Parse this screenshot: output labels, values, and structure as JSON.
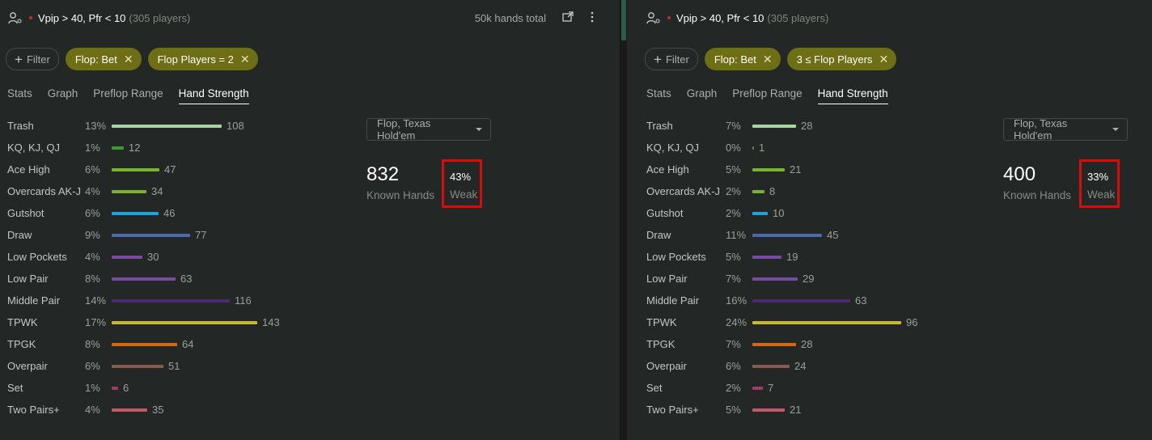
{
  "colors": {
    "chip": "#6e6e14",
    "highlight_box": "#d90b0b",
    "bars": {
      "trash": "#a8d5a2",
      "kq": "#3a9a2a",
      "ace_high": "#7ab32e",
      "overcards": "#7ab32e",
      "gutshot": "#1aa6d9",
      "draw": "#4a6aad",
      "low_pockets": "#7a4aa0",
      "low_pair": "#7a4aa0",
      "middle_pair": "#4a2a70",
      "tpwk": "#c9b82a",
      "tpgk": "#d06a18",
      "overpair": "#8a5a50",
      "set": "#a03a6a",
      "two_pairs": "#c05a6a"
    }
  },
  "left": {
    "segment": "Vpip > 40, Pfr < 10",
    "player_count": "(305 players)",
    "hands_total": "50k hands total",
    "filter_label": "Filter",
    "chips": [
      "Flop: Bet",
      "Flop Players = 2"
    ],
    "tabs": [
      "Stats",
      "Graph",
      "Preflop Range",
      "Hand Strength"
    ],
    "dropdown": "Flop, Texas Hold'em",
    "known_hands": "832",
    "known_hands_label": "Known Hands",
    "weak_pct": "43%",
    "weak_label": "Weak",
    "rows": [
      {
        "label": "Trash",
        "pct": "13%",
        "count": "108",
        "color": "trash"
      },
      {
        "label": "KQ, KJ, QJ",
        "pct": "1%",
        "count": "12",
        "color": "kq"
      },
      {
        "label": "Ace High",
        "pct": "6%",
        "count": "47",
        "color": "ace_high"
      },
      {
        "label": "Overcards AK-J",
        "pct": "4%",
        "count": "34",
        "color": "overcards"
      },
      {
        "label": "Gutshot",
        "pct": "6%",
        "count": "46",
        "color": "gutshot"
      },
      {
        "label": "Draw",
        "pct": "9%",
        "count": "77",
        "color": "draw"
      },
      {
        "label": "Low Pockets",
        "pct": "4%",
        "count": "30",
        "color": "low_pockets"
      },
      {
        "label": "Low Pair",
        "pct": "8%",
        "count": "63",
        "color": "low_pair"
      },
      {
        "label": "Middle Pair",
        "pct": "14%",
        "count": "116",
        "color": "middle_pair"
      },
      {
        "label": "TPWK",
        "pct": "17%",
        "count": "143",
        "color": "tpwk"
      },
      {
        "label": "TPGK",
        "pct": "8%",
        "count": "64",
        "color": "tpgk"
      },
      {
        "label": "Overpair",
        "pct": "6%",
        "count": "51",
        "color": "overpair"
      },
      {
        "label": "Set",
        "pct": "1%",
        "count": "6",
        "color": "set"
      },
      {
        "label": "Two Pairs+",
        "pct": "4%",
        "count": "35",
        "color": "two_pairs"
      }
    ]
  },
  "right": {
    "segment": "Vpip > 40, Pfr < 10",
    "player_count": "(305 players)",
    "filter_label": "Filter",
    "chips": [
      "Flop: Bet",
      "3 ≤ Flop Players"
    ],
    "tabs": [
      "Stats",
      "Graph",
      "Preflop Range",
      "Hand Strength"
    ],
    "dropdown": "Flop, Texas Hold'em",
    "known_hands": "400",
    "known_hands_label": "Known Hands",
    "weak_pct": "33%",
    "weak_label": "Weak",
    "rows": [
      {
        "label": "Trash",
        "pct": "7%",
        "count": "28",
        "color": "trash"
      },
      {
        "label": "KQ, KJ, QJ",
        "pct": "0%",
        "count": "1",
        "color": "kq"
      },
      {
        "label": "Ace High",
        "pct": "5%",
        "count": "21",
        "color": "ace_high"
      },
      {
        "label": "Overcards AK-J",
        "pct": "2%",
        "count": "8",
        "color": "overcards"
      },
      {
        "label": "Gutshot",
        "pct": "2%",
        "count": "10",
        "color": "gutshot"
      },
      {
        "label": "Draw",
        "pct": "11%",
        "count": "45",
        "color": "draw"
      },
      {
        "label": "Low Pockets",
        "pct": "5%",
        "count": "19",
        "color": "low_pockets"
      },
      {
        "label": "Low Pair",
        "pct": "7%",
        "count": "29",
        "color": "low_pair"
      },
      {
        "label": "Middle Pair",
        "pct": "16%",
        "count": "63",
        "color": "middle_pair"
      },
      {
        "label": "TPWK",
        "pct": "24%",
        "count": "96",
        "color": "tpwk"
      },
      {
        "label": "TPGK",
        "pct": "7%",
        "count": "28",
        "color": "tpgk"
      },
      {
        "label": "Overpair",
        "pct": "6%",
        "count": "24",
        "color": "overpair"
      },
      {
        "label": "Set",
        "pct": "2%",
        "count": "7",
        "color": "set"
      },
      {
        "label": "Two Pairs+",
        "pct": "5%",
        "count": "21",
        "color": "two_pairs"
      }
    ]
  }
}
